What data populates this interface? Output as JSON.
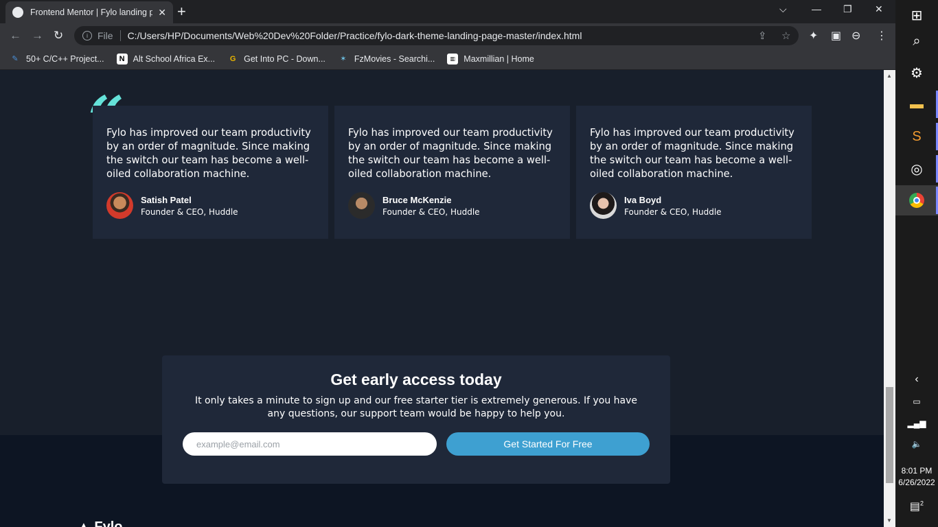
{
  "browser": {
    "tab_title": "Frontend Mentor | Fylo landing p",
    "url": "C:/Users/HP/Documents/Web%20Dev%20Folder/Practice/fylo-dark-theme-landing-page-master/index.html",
    "scheme_label": "File",
    "bookmarks": [
      {
        "label": "50+ C/C++ Project...",
        "icon": "pen-icon"
      },
      {
        "label": "Alt School Africa Ex...",
        "icon": "notion-icon"
      },
      {
        "label": "Get Into PC - Down...",
        "icon": "g-icon"
      },
      {
        "label": "FzMovies - Searchi...",
        "icon": "fz-icon"
      },
      {
        "label": "Maxmillian | Home",
        "icon": "max-icon"
      }
    ]
  },
  "testimonials": [
    {
      "quote": "Fylo has improved our team productivity by an order of magnitude. Since making the switch our team has become a well-oiled collaboration machine.",
      "name": "Satish Patel",
      "role": "Founder & CEO, Huddle"
    },
    {
      "quote": "Fylo has improved our team productivity by an order of magnitude. Since making the switch our team has become a well-oiled collaboration machine.",
      "name": "Bruce McKenzie",
      "role": "Founder & CEO, Huddle"
    },
    {
      "quote": "Fylo has improved our team productivity by an order of magnitude. Since making the switch our team has become a well-oiled collaboration machine.",
      "name": "Iva Boyd",
      "role": "Founder & CEO, Huddle"
    }
  ],
  "cta": {
    "title": "Get early access today",
    "text": "It only takes a minute to sign up and our free starter tier is extremely generous. If you have any questions, our support team would be happy to help you.",
    "email_placeholder": "example@email.com",
    "button": "Get Started For Free"
  },
  "taskbar": {
    "time": "8:01 PM",
    "date": "6/26/2022",
    "notifications": "2"
  },
  "colors": {
    "accent_cyan": "#65e2d9",
    "button_blue": "#3ea0d1",
    "card_bg": "#1f2839",
    "page_bg": "#181f2b"
  }
}
